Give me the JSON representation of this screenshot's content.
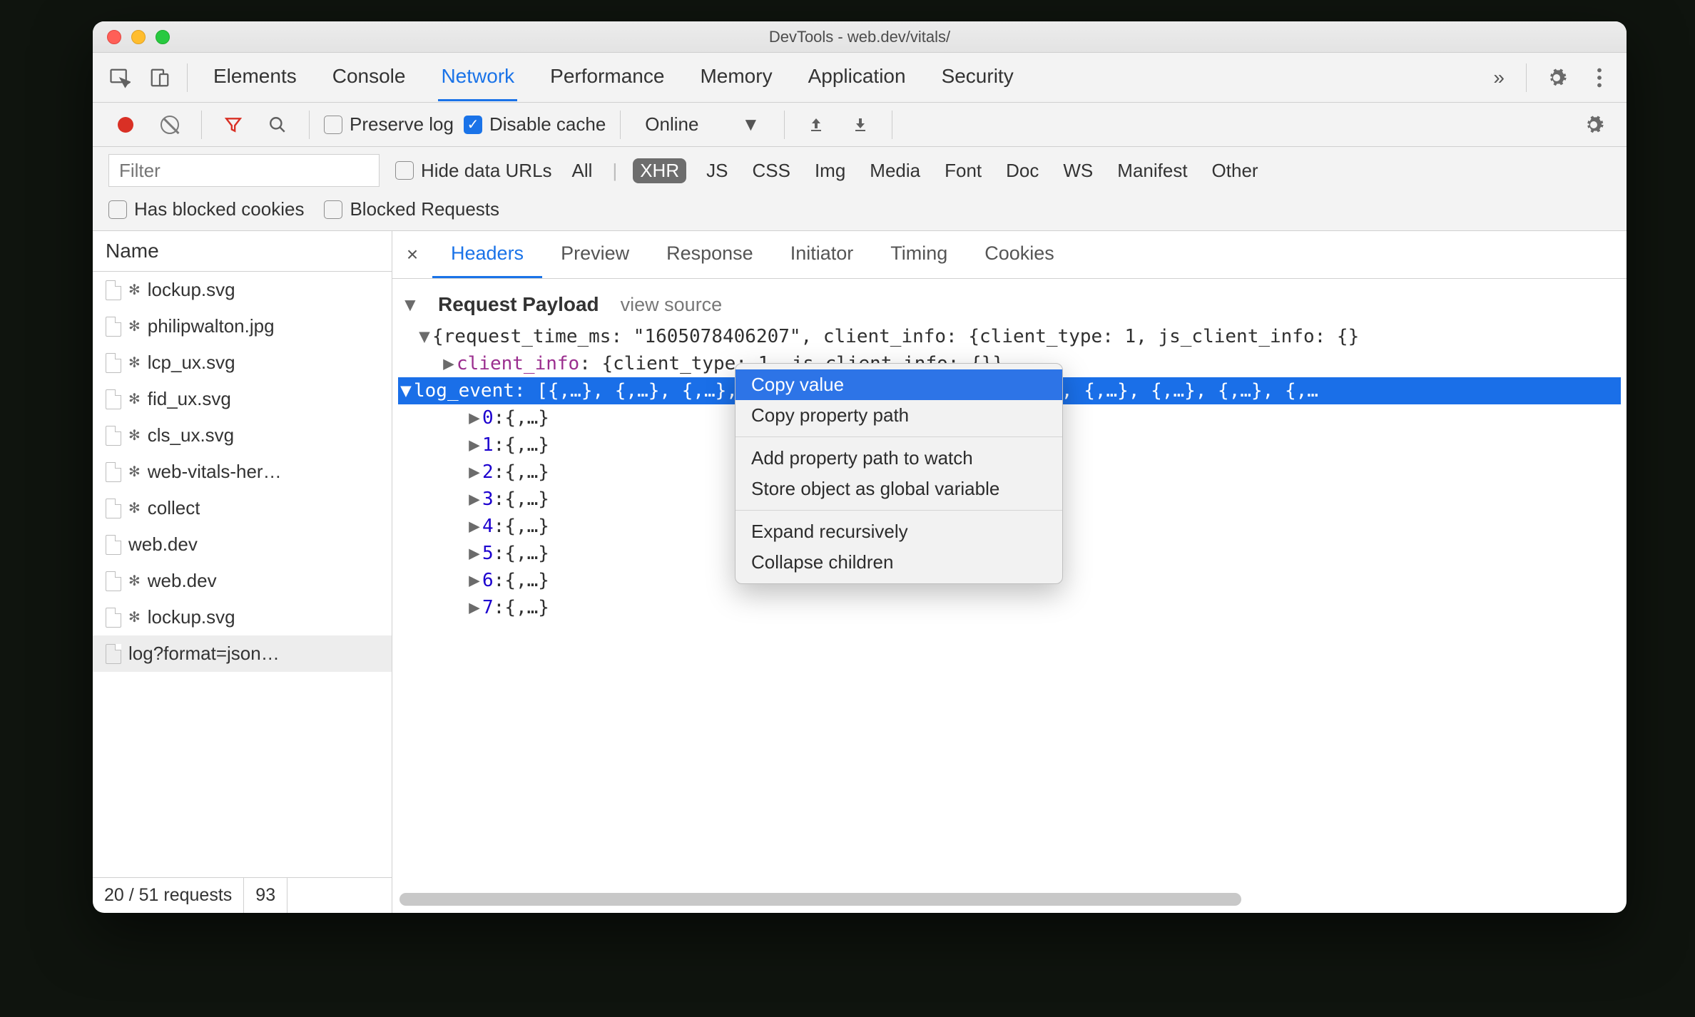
{
  "window": {
    "title": "DevTools - web.dev/vitals/"
  },
  "panel_tabs": [
    "Elements",
    "Console",
    "Network",
    "Performance",
    "Memory",
    "Application",
    "Security"
  ],
  "panel_active": "Network",
  "toolbar": {
    "preserve_log": "Preserve log",
    "disable_cache": "Disable cache",
    "throttling": "Online"
  },
  "filter": {
    "placeholder": "Filter",
    "hide_data_urls": "Hide data URLs",
    "types": [
      "All",
      "XHR",
      "JS",
      "CSS",
      "Img",
      "Media",
      "Font",
      "Doc",
      "WS",
      "Manifest",
      "Other"
    ],
    "type_active": "XHR",
    "has_blocked": "Has blocked cookies",
    "blocked_requests": "Blocked Requests"
  },
  "sidebar": {
    "header": "Name",
    "requests": [
      {
        "name": "lockup.svg",
        "gear": true
      },
      {
        "name": "philipwalton.jpg",
        "gear": true
      },
      {
        "name": "lcp_ux.svg",
        "gear": true
      },
      {
        "name": "fid_ux.svg",
        "gear": true
      },
      {
        "name": "cls_ux.svg",
        "gear": true
      },
      {
        "name": "web-vitals-her…",
        "gear": true
      },
      {
        "name": "collect",
        "gear": true
      },
      {
        "name": "web.dev",
        "gear": false
      },
      {
        "name": "web.dev",
        "gear": true
      },
      {
        "name": "lockup.svg",
        "gear": true
      },
      {
        "name": "log?format=json…",
        "gear": false,
        "selected": true
      }
    ],
    "status_left": "20 / 51 requests",
    "status_right": "93"
  },
  "detail_tabs": [
    "Headers",
    "Preview",
    "Response",
    "Initiator",
    "Timing",
    "Cookies"
  ],
  "detail_active": "Headers",
  "payload": {
    "section_title": "Request Payload",
    "view_source": "view source",
    "root_line": "{request_time_ms: \"1605078406207\", client_info: {client_type: 1, js_client_info: {}",
    "client_info_key": "client_info",
    "client_info_val": "{client_type: 1, js_client_info: {}}",
    "log_event_key": "log_event",
    "log_event_tail": "[{,…}, {,…}, {,…}, {,…}, {,…}, {,…}, {,…}, {,…}, {,…}, {,…}, {,…}, {,…",
    "indices": [
      "0",
      "1",
      "2",
      "3",
      "4",
      "5",
      "6",
      "7"
    ],
    "child_val": "{,…}"
  },
  "context_menu": {
    "items": [
      {
        "label": "Copy value",
        "selected": true
      },
      {
        "label": "Copy property path"
      },
      {
        "sep": true
      },
      {
        "label": "Add property path to watch"
      },
      {
        "label": "Store object as global variable"
      },
      {
        "sep": true
      },
      {
        "label": "Expand recursively"
      },
      {
        "label": "Collapse children"
      }
    ]
  }
}
